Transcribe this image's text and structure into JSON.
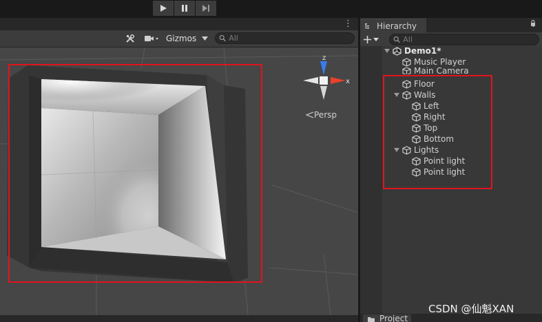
{
  "toolbar": {
    "buttons": [
      {
        "name": "play-button",
        "icon": "play-icon"
      },
      {
        "name": "pause-button",
        "icon": "pause-icon"
      },
      {
        "name": "step-button",
        "icon": "step-forward-icon"
      }
    ]
  },
  "scene": {
    "gizmos_label": "Gizmos",
    "search_placeholder": "All",
    "gizmo": {
      "y_axis_label": "z",
      "x_axis_label": "x",
      "projection_label": "Persp"
    },
    "highlight_color": "#e0141e"
  },
  "hierarchy": {
    "tab_label": "Hierarchy",
    "search_placeholder": "All",
    "scene_name": "Demo1*",
    "items": [
      {
        "label": "Music Player",
        "depth": 1,
        "foldout": false
      },
      {
        "label": "Main Camera",
        "depth": 1,
        "foldout": false
      },
      {
        "label": "Floor",
        "depth": 1,
        "foldout": false
      },
      {
        "label": "Walls",
        "depth": 1,
        "foldout": true
      },
      {
        "label": "Left",
        "depth": 2,
        "foldout": false
      },
      {
        "label": "Right",
        "depth": 2,
        "foldout": false
      },
      {
        "label": "Top",
        "depth": 2,
        "foldout": false
      },
      {
        "label": "Bottom",
        "depth": 2,
        "foldout": false
      },
      {
        "label": "Lights",
        "depth": 1,
        "foldout": true
      },
      {
        "label": "Point light",
        "depth": 2,
        "foldout": false
      },
      {
        "label": "Point light",
        "depth": 2,
        "foldout": false
      }
    ]
  },
  "project": {
    "tab_label": "Project"
  },
  "watermark": "CSDN @仙魁XAN"
}
